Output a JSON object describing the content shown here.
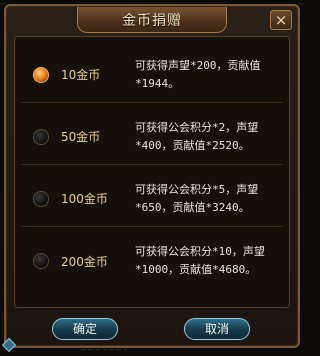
{
  "dialog": {
    "title": "金币捐赠",
    "close_icon": "×"
  },
  "options": [
    {
      "label": "10金币",
      "desc_line1": "可获得声望*200，贡献值",
      "desc_line2": "*1944。",
      "selected": true
    },
    {
      "label": "50金币",
      "desc_line1": "可获得公会积分*2，声望",
      "desc_line2": "*400，贡献值*2520。",
      "selected": false
    },
    {
      "label": "100金币",
      "desc_line1": "可获得公会积分*5，声望",
      "desc_line2": "*650，贡献值*3240。",
      "selected": false
    },
    {
      "label": "200金币",
      "desc_line1": "可获得公会积分*10，声望",
      "desc_line2": "*1000，贡献值*4680。",
      "selected": false
    }
  ],
  "buttons": {
    "confirm": "确定",
    "cancel": "取消"
  },
  "background": {
    "fragment1": "759752",
    "fragment2": "2216228"
  },
  "colors": {
    "frame": "#7a5a36",
    "selected_radio": "#e0741a",
    "button": "#2f6f8a"
  }
}
